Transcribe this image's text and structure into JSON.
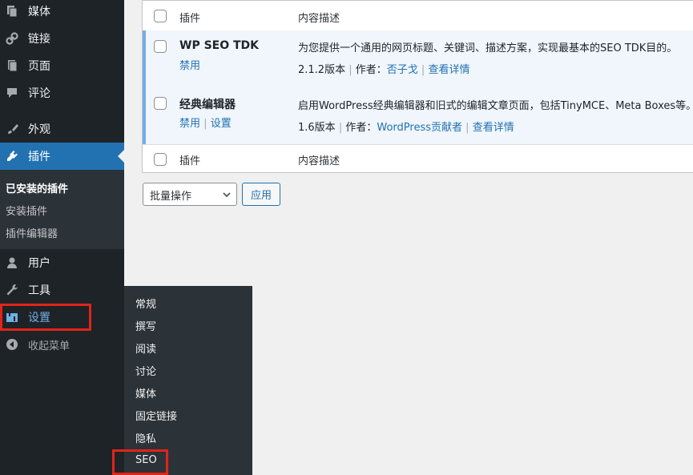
{
  "sidebar": {
    "items": [
      {
        "label": "媒体",
        "icon": "media-icon"
      },
      {
        "label": "链接",
        "icon": "link-icon"
      },
      {
        "label": "页面",
        "icon": "pages-icon"
      },
      {
        "label": "评论",
        "icon": "comments-icon"
      },
      {
        "label": "外观",
        "icon": "appearance-icon"
      },
      {
        "label": "插件",
        "icon": "plugins-icon"
      },
      {
        "label": "用户",
        "icon": "users-icon"
      },
      {
        "label": "工具",
        "icon": "tools-icon"
      },
      {
        "label": "设置",
        "icon": "settings-icon"
      },
      {
        "label": "收起菜单",
        "icon": "collapse-icon"
      }
    ],
    "plugins_submenu": [
      "已安装的插件",
      "安装插件",
      "插件编辑器"
    ]
  },
  "settings_flyout": [
    "常规",
    "撰写",
    "阅读",
    "讨论",
    "媒体",
    "固定链接",
    "隐私",
    "SEO"
  ],
  "table": {
    "col_plugin": "插件",
    "col_desc": "内容描述",
    "rows": [
      {
        "name": "WP SEO TDK",
        "action1": "禁用",
        "description": "为您提供一个通用的网页标题、关键词、描述方案，实现最基本的SEO TDK目的。",
        "version": "2.1.2版本",
        "author_label": "作者：",
        "author": "否子戈",
        "details": "查看详情"
      },
      {
        "name": "经典编辑器",
        "action1": "禁用",
        "action2": "设置",
        "description": "启用WordPress经典编辑器和旧式的编辑文章页面，包括TinyMCE、Meta Boxes等。支持",
        "version": "1.6版本",
        "author_label": "作者：",
        "author": "WordPress贡献者",
        "details": "查看详情"
      }
    ],
    "sep": "|"
  },
  "bulk": {
    "select_value": "批量操作",
    "apply_label": "应用"
  },
  "colors": {
    "sidebar_bg": "#1d2327",
    "accent": "#2271b1",
    "highlight_box": "#e2231a"
  }
}
